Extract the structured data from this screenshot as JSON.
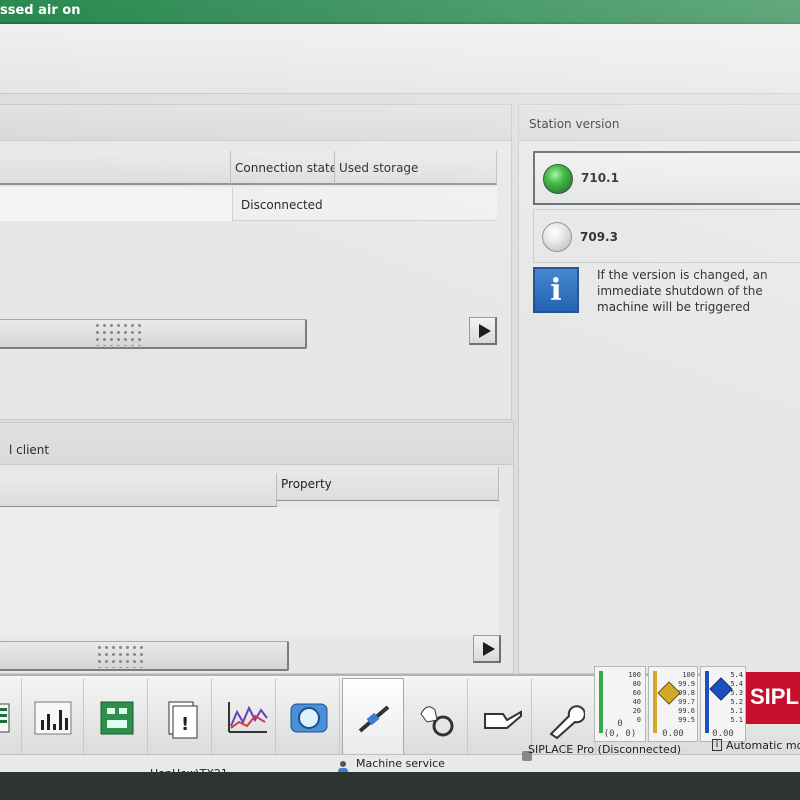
{
  "window": {
    "title": "ssed air on"
  },
  "connections_panel": {
    "columns": [
      "Connection state",
      "Used storage"
    ],
    "rows": [
      {
        "state": "Disconnected",
        "storage": ""
      }
    ]
  },
  "client_panel": {
    "title": "l client",
    "columns": [
      "Property"
    ]
  },
  "station_version": {
    "title": "Station version",
    "versions": [
      {
        "label": "710.1",
        "active": true
      },
      {
        "label": "709.3",
        "active": false
      }
    ],
    "info_icon": "info-icon",
    "info_text": "If the version is changed, an immediate shutdown of the machine will be triggered"
  },
  "toolbar": {
    "buttons": [
      {
        "name": "list-icon"
      },
      {
        "name": "bar-chart-icon"
      },
      {
        "name": "circuit-board-icon"
      },
      {
        "name": "document-warning-icon"
      },
      {
        "name": "line-chart-icon"
      },
      {
        "name": "camera-icon"
      },
      {
        "name": "machine-service-icon",
        "active": true
      },
      {
        "name": "hand-gear-icon"
      },
      {
        "name": "oil-can-icon"
      },
      {
        "name": "wrench-icon"
      }
    ]
  },
  "widgets": [
    {
      "values": [
        "100",
        "80",
        "60",
        "40",
        "20",
        "0"
      ],
      "foot_top": "0",
      "foot": "(0, 0)",
      "color": "#3aa84a"
    },
    {
      "values": [
        "100",
        "99.9",
        "99.8",
        "99.7",
        "99.6",
        "99.5"
      ],
      "foot_top": "",
      "foot": "0.00",
      "color": "#d4a92a"
    },
    {
      "values": [
        "5.4",
        "5.4",
        "5.3",
        "5.2",
        "5.1",
        "5.1"
      ],
      "foot_top": "",
      "foot": "0.00",
      "color": "#1c4fbf"
    }
  ],
  "status": {
    "line_name": "HonHow\\TX21",
    "service_label": "Machine service",
    "connection": "SIPLACE Pro (Disconnected)",
    "mode": "Automatic mo"
  },
  "logo": {
    "text": "SIPL",
    "color": "#c8102e"
  }
}
